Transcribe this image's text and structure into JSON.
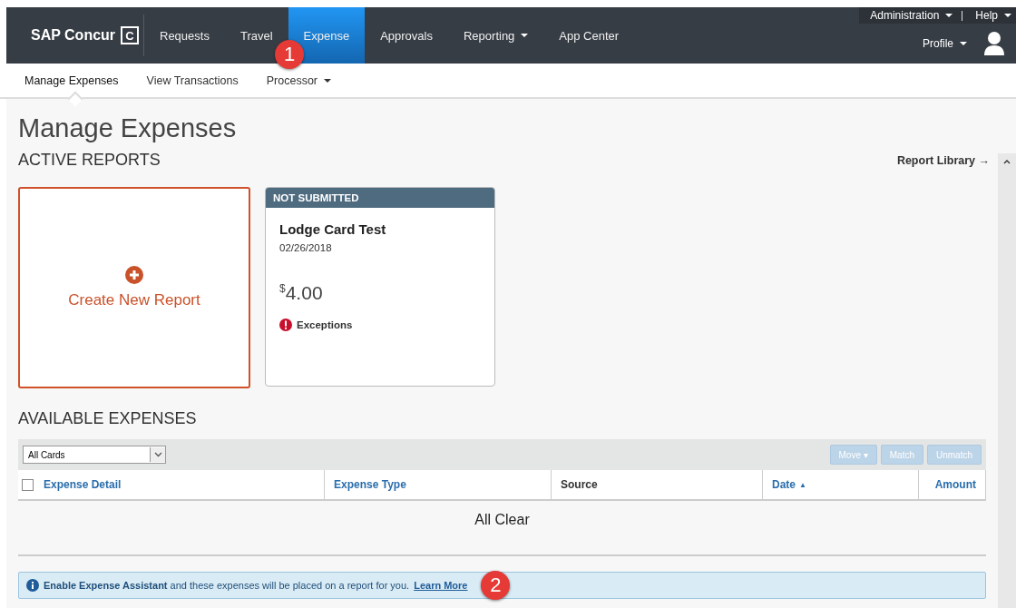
{
  "brand": {
    "name": "SAP Concur",
    "mark": "C"
  },
  "nav": [
    {
      "label": "Requests",
      "selected": false,
      "has_menu": false
    },
    {
      "label": "Travel",
      "selected": false,
      "has_menu": false
    },
    {
      "label": "Expense",
      "selected": true,
      "has_menu": false
    },
    {
      "label": "Approvals",
      "selected": false,
      "has_menu": false
    },
    {
      "label": "Reporting",
      "selected": false,
      "has_menu": true
    },
    {
      "label": "App Center",
      "selected": false,
      "has_menu": false
    }
  ],
  "top_links": [
    {
      "label": "Administration"
    },
    {
      "label": "Help"
    }
  ],
  "profile": {
    "label": "Profile"
  },
  "subnav": [
    {
      "label": "Manage Expenses",
      "selected": true,
      "has_menu": false
    },
    {
      "label": "View Transactions",
      "selected": false,
      "has_menu": false
    },
    {
      "label": "Processor",
      "selected": false,
      "has_menu": true
    }
  ],
  "page_title": "Manage Expenses",
  "active_reports": {
    "heading": "ACTIVE REPORTS",
    "library_link": "Report Library →",
    "create_card": {
      "label": "Create New Report"
    },
    "reports": [
      {
        "status": "NOT SUBMITTED",
        "name": "Lodge Card Test",
        "date": "02/26/2018",
        "currency": "$",
        "amount": "4.00",
        "alert": "Exceptions"
      }
    ]
  },
  "available_expenses": {
    "heading": "AVAILABLE EXPENSES",
    "filter": {
      "value": "All Cards"
    },
    "buttons": [
      {
        "label": "Move ▾",
        "disabled": true
      },
      {
        "label": "Match",
        "disabled": true
      },
      {
        "label": "Unmatch",
        "disabled": true
      }
    ],
    "select_all": {
      "checked": false
    },
    "columns": [
      {
        "label": "Expense Detail",
        "kind": "link"
      },
      {
        "label": "Expense Type",
        "kind": "link"
      },
      {
        "label": "Source",
        "kind": "plain"
      },
      {
        "label": "Date",
        "kind": "link",
        "sort": "▲"
      },
      {
        "label": "Amount",
        "kind": "link"
      }
    ],
    "empty_message": "All Clear"
  },
  "assistant_banner": {
    "bold": "Enable Expense Assistant",
    "text": "and these expenses will be placed on a report for you.",
    "link": "Learn More"
  },
  "callouts": [
    "1",
    "2"
  ]
}
